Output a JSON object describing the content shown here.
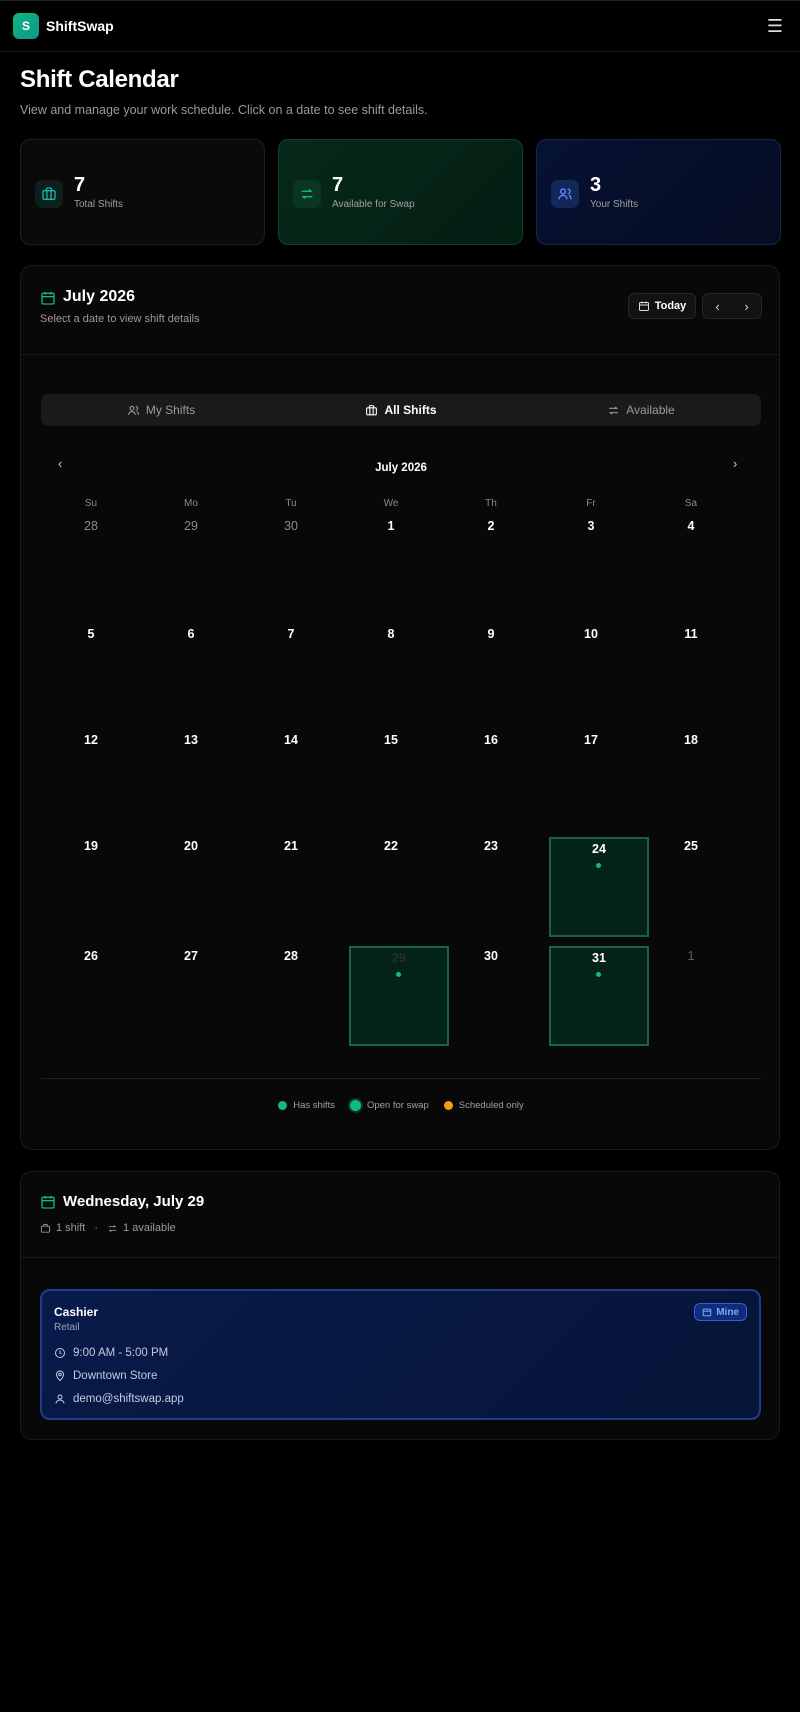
{
  "app": {
    "logo_letter": "S",
    "name": "ShiftSwap"
  },
  "header": {
    "menu_icon": "hamburger-icon"
  },
  "page": {
    "title": "Shift Calendar",
    "subtitle": "View and manage your work schedule. Click on a date to see shift details."
  },
  "stats": [
    {
      "value": "7",
      "label": "Total Shifts",
      "icon": "briefcase-icon"
    },
    {
      "value": "7",
      "label": "Available for Swap",
      "icon": "swap-icon"
    },
    {
      "value": "3",
      "label": "Your Shifts",
      "icon": "users-icon"
    }
  ],
  "calendar": {
    "title": "July 2026",
    "subtitle": "Select a date to view shift details",
    "today_label": "Today",
    "tabs": [
      {
        "label": "My Shifts",
        "icon": "users-icon",
        "active": false
      },
      {
        "label": "All Shifts",
        "icon": "briefcase-icon",
        "active": true
      },
      {
        "label": "Available",
        "icon": "swap-icon",
        "active": false
      }
    ],
    "month_label": "July 2026",
    "weekdays": [
      "Su",
      "Mo",
      "Tu",
      "We",
      "Th",
      "Fr",
      "Sa"
    ],
    "weeks": [
      [
        "28",
        "29",
        "30",
        "1",
        "2",
        "3",
        "4"
      ],
      [
        "5",
        "6",
        "7",
        "8",
        "9",
        "10",
        "11"
      ],
      [
        "12",
        "13",
        "14",
        "15",
        "16",
        "17",
        "18"
      ],
      [
        "19",
        "20",
        "21",
        "22",
        "23",
        "24",
        "25"
      ],
      [
        "26",
        "27",
        "28",
        "29",
        "30",
        "31",
        "1"
      ]
    ],
    "days_with_shifts": [
      "24",
      "29",
      "31"
    ],
    "legend": [
      {
        "label": "Has shifts",
        "color": "#10b981"
      },
      {
        "label": "Open for swap",
        "color": "#10b981"
      },
      {
        "label": "Scheduled only",
        "color": "#f59e0b"
      }
    ]
  },
  "detail": {
    "title": "Wednesday, July 29",
    "shift_count": "1 shift",
    "available_count": "1 available",
    "shift": {
      "role": "Cashier",
      "department": "Retail",
      "badge": "Mine",
      "time": "9:00 AM - 5:00 PM",
      "location": "Downtown Store",
      "email": "demo@shiftswap.app"
    }
  }
}
